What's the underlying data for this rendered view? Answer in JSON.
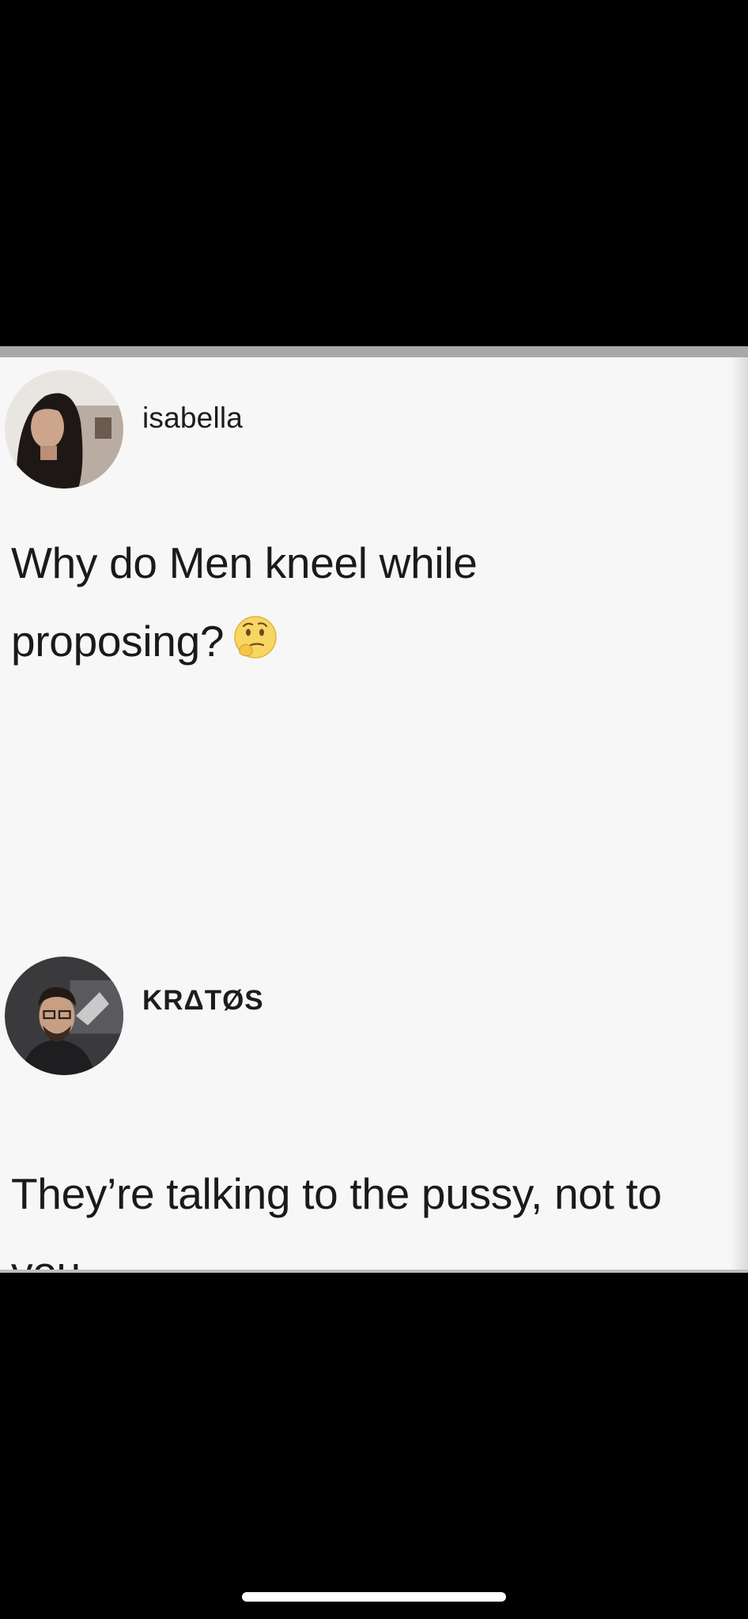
{
  "post": {
    "author": "isabella",
    "text_line1": "Why do Men kneel while",
    "text_line2": "proposing?",
    "emoji": "thinking-face-icon"
  },
  "reply": {
    "author": "KRΔTØS",
    "text_line1": "They’re talking to the pussy, not to",
    "text_line2": "you."
  },
  "colors": {
    "background": "#000000",
    "card": "#f7f7f7",
    "text": "#1a1a1a",
    "home_indicator": "#ffffff"
  }
}
